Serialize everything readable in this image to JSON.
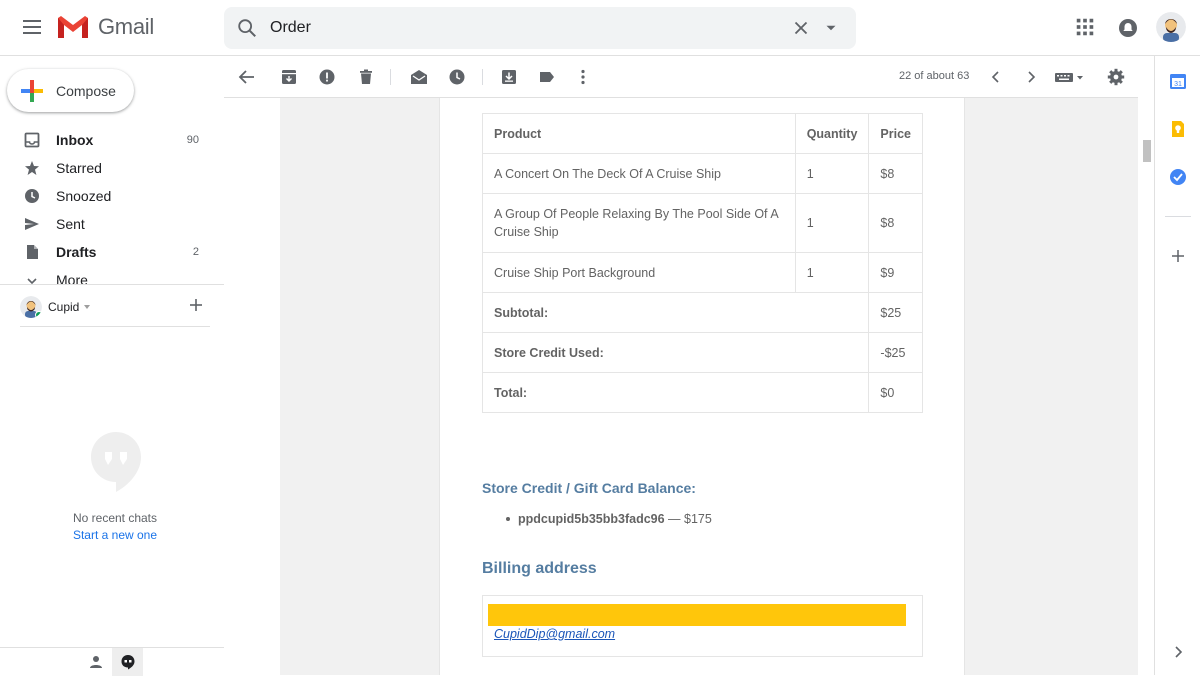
{
  "app": {
    "name": "Gmail"
  },
  "search": {
    "value": "Order"
  },
  "compose": {
    "label": "Compose"
  },
  "nav": {
    "items": [
      {
        "label": "Inbox",
        "count": "90"
      },
      {
        "label": "Starred",
        "count": ""
      },
      {
        "label": "Snoozed",
        "count": ""
      },
      {
        "label": "Sent",
        "count": ""
      },
      {
        "label": "Drafts",
        "count": "2"
      },
      {
        "label": "More",
        "count": ""
      }
    ]
  },
  "hangouts": {
    "user": "Cupid",
    "no_chats": "No recent chats",
    "start_new": "Start a new one"
  },
  "toolbar": {
    "pager": "22 of about 63"
  },
  "email": {
    "table": {
      "headers": [
        "Product",
        "Quantity",
        "Price"
      ],
      "rows": [
        {
          "product": "A Concert On The Deck Of A Cruise Ship",
          "qty": "1",
          "price": "$8"
        },
        {
          "product": "A Group Of People Relaxing By The Pool Side Of A Cruise Ship",
          "qty": "1",
          "price": "$8"
        },
        {
          "product": "Cruise Ship Port Background",
          "qty": "1",
          "price": "$9"
        }
      ],
      "totals": [
        {
          "label": "Subtotal:",
          "value": "$25"
        },
        {
          "label": "Store Credit Used:",
          "value": "-$25"
        },
        {
          "label": "Total:",
          "value": "$0"
        }
      ]
    },
    "credit_title": "Store Credit / Gift Card Balance:",
    "credit_code": "ppdcupid5b35bb3fadc96",
    "credit_amount": "— $175",
    "billing_title": "Billing address",
    "billing_email": "CupidDip@gmail.com"
  },
  "colors": {
    "accent": "#557da1",
    "redaction": "#ffc60b",
    "link": "#1a55b8"
  }
}
